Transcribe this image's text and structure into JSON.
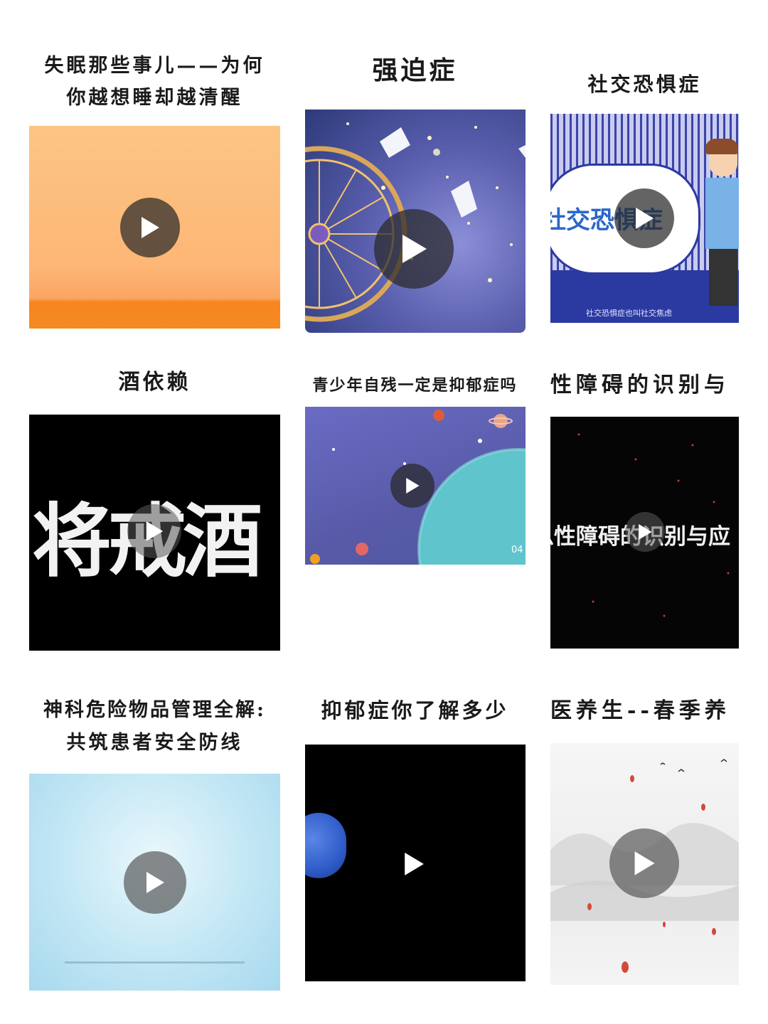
{
  "videos": [
    {
      "title_line1": "失眠那些事儿——为何",
      "title_line2": "你越想睡却越清醒"
    },
    {
      "title_line1": "强迫症"
    },
    {
      "title_line1": "社交恐惧症",
      "overlay_text": "社交恐惧症",
      "caption": "社交恐惧症也叫社交焦虑"
    },
    {
      "title_line1": "酒依赖",
      "overlay_text": "将戒酒"
    },
    {
      "title_line1": "青少年自残一定是抑郁症吗",
      "timestamp": "04"
    },
    {
      "title_line1": "性障碍的识别与",
      "overlay_text": "急性障碍的识别与应"
    },
    {
      "title_line1": "神科危险物品管理全解:",
      "title_line2": "共筑患者安全防线"
    },
    {
      "title_line1": "抑郁症你了解多少"
    },
    {
      "title_line1": "医养生--春季养"
    }
  ],
  "icons": {
    "play": "play-icon"
  },
  "colors": {
    "play_bg": "#3a3a3a",
    "title": "#1a1a1a"
  }
}
